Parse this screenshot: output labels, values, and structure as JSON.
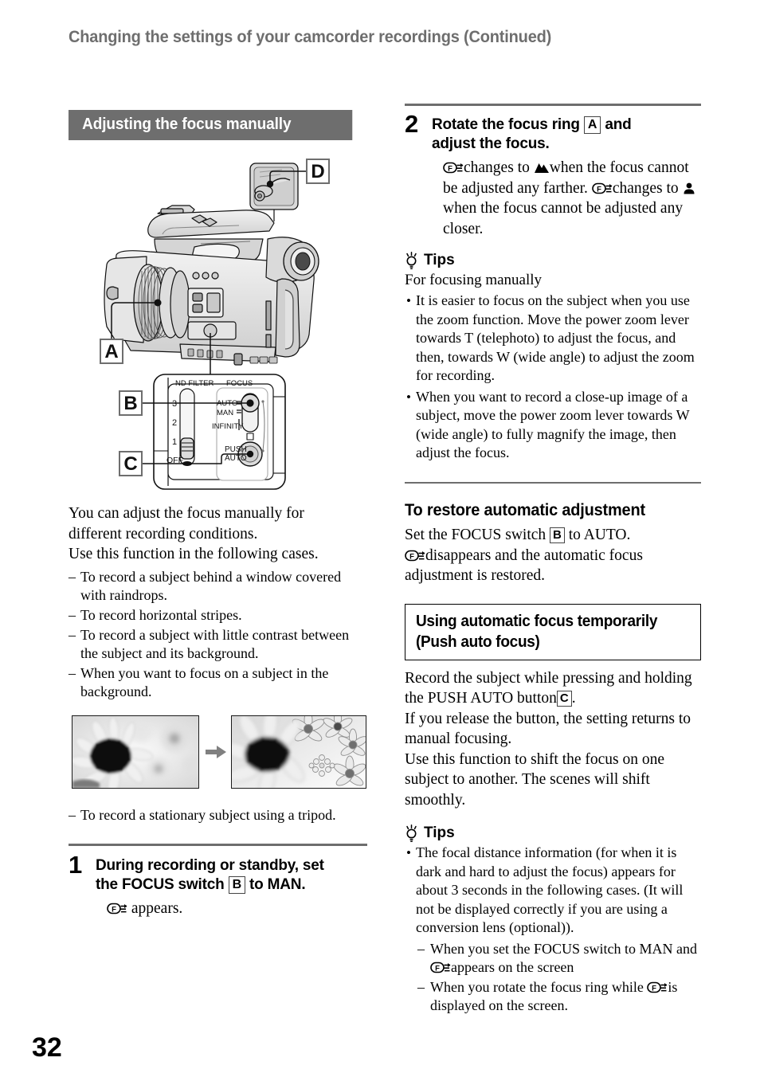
{
  "running_head": "Changing the settings of your camcorder recordings (Continued)",
  "page_number": "32",
  "colors": {
    "band_gray": "#6e6e6e",
    "rule_gray": "#6e6e6e",
    "text_black": "#000000"
  },
  "left_column": {
    "section_title": "Adjusting the focus manually",
    "figure": {
      "callouts": [
        "A",
        "B",
        "C",
        "D"
      ],
      "panel_labels": {
        "nd_filter": "ND FILTER",
        "focus": "FOCUS",
        "nd_positions": [
          "3",
          "2",
          "1",
          "OFF"
        ],
        "focus_auto": "AUTO",
        "focus_man": "MAN",
        "focus_infinity": "INFINITY",
        "push_auto_line1": "PUSH",
        "push_auto_line2": "AUTO"
      }
    },
    "intro_line1": "You can adjust the focus manually for",
    "intro_line2": "different recording conditions.",
    "intro_line3": "Use this function in the following cases.",
    "cases": [
      "To record a subject behind a window covered with raindrops.",
      "To record horizontal stripes.",
      "To record a subject with little contrast between the subject and its background.",
      "When you want to focus on a subject in the background."
    ],
    "case_after_photos": "To record a stationary subject using a tripod.",
    "step1": {
      "number": "1",
      "title_part1": "During recording or standby, set",
      "title_part2a": "the FOCUS switch",
      "title_key": "B",
      "title_part2b": "to MAN.",
      "body_after_icon": "appears."
    }
  },
  "right_column": {
    "step2": {
      "number": "2",
      "title_part1": "Rotate the focus ring",
      "title_key": "A",
      "title_part2": "and",
      "title_line2": "adjust the focus.",
      "body_a": "changes to",
      "body_b": "when the focus cannot be adjusted any farther.",
      "body_c": "changes to",
      "body_d": "when the focus cannot be adjusted any closer."
    },
    "tips1": {
      "label": "Tips",
      "intro": "For focusing manually",
      "bullets": [
        "It is easier to focus on the subject when you use the zoom function. Move the power zoom lever towards T (telephoto) to adjust the focus, and then, towards W (wide angle) to adjust the zoom for recording.",
        "When you want to record a close-up image of a subject, move the power zoom lever towards W (wide angle) to fully magnify the image, then adjust the focus."
      ]
    },
    "restore": {
      "heading": "To restore automatic adjustment",
      "line1a": "Set the FOCUS switch",
      "line1_key": "B",
      "line1b": "to AUTO.",
      "line2": "disappears and the automatic focus adjustment is restored."
    },
    "push_auto": {
      "heading_line1": "Using automatic focus temporarily",
      "heading_line2": "(Push auto focus)",
      "para1a": "Record the subject while pressing and holding the PUSH AUTO button",
      "para1_key": "C",
      "para1b": ".",
      "para2": "If you release the button, the setting returns to manual focusing.",
      "para3": "Use this function to shift the focus on one subject to another. The scenes will shift smoothly."
    },
    "tips2": {
      "label": "Tips",
      "bullet1": "The focal distance information (for when it is dark and hard to adjust the focus) appears for about 3 seconds in the following cases. (It will not be displayed correctly if you are using a conversion lens (optional)).",
      "sub1a": "When you set the FOCUS switch to MAN and",
      "sub1b": "appears on the screen",
      "sub2a": "When you rotate the focus ring while",
      "sub2b": "is displayed on the screen."
    }
  },
  "icons": {
    "manual_focus": "manual-focus-icon",
    "mountain": "mountain-infinity-icon",
    "person": "person-closeup-icon",
    "tips_bulb": "lightbulb-icon",
    "arrow": "right-arrow-icon"
  }
}
